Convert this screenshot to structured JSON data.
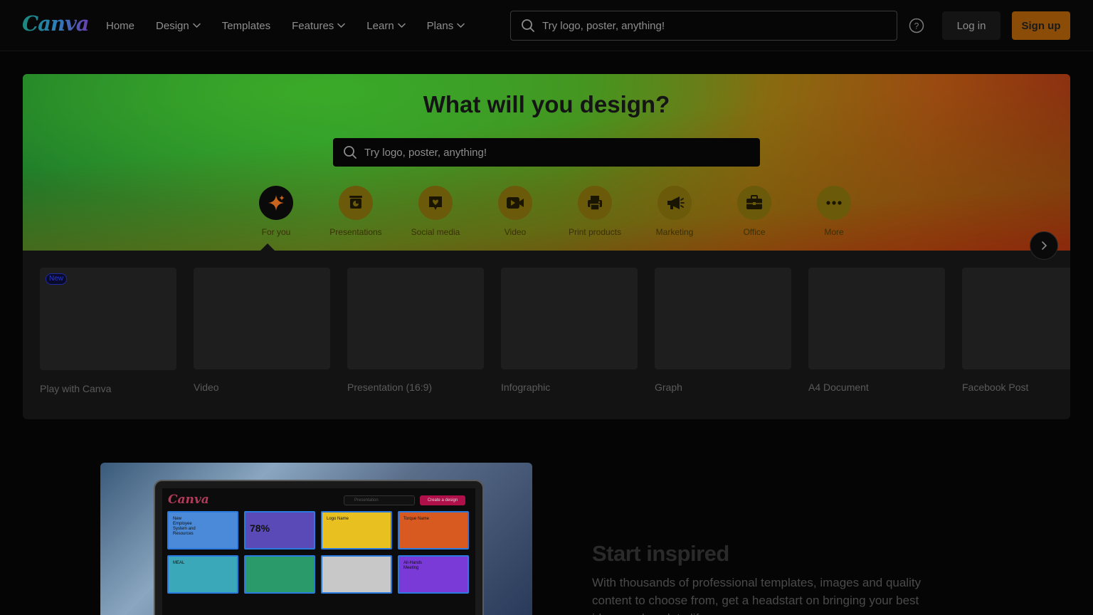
{
  "header": {
    "logo": "Canva",
    "nav": [
      {
        "label": "Home",
        "dropdown": false
      },
      {
        "label": "Design",
        "dropdown": true
      },
      {
        "label": "Templates",
        "dropdown": false
      },
      {
        "label": "Features",
        "dropdown": true
      },
      {
        "label": "Learn",
        "dropdown": true
      },
      {
        "label": "Plans",
        "dropdown": true
      }
    ],
    "search_placeholder": "Try logo, poster, anything!",
    "help_icon": "question-circle-icon",
    "login_label": "Log in",
    "signup_label": "Sign up"
  },
  "hero": {
    "title": "What will you design?",
    "search_placeholder": "Try logo, poster, anything!",
    "categories": [
      {
        "label": "For you",
        "icon": "sparkle-icon",
        "active": true
      },
      {
        "label": "Presentations",
        "icon": "presentation-icon",
        "active": false
      },
      {
        "label": "Social media",
        "icon": "heart-chat-icon",
        "active": false
      },
      {
        "label": "Video",
        "icon": "video-camera-icon",
        "active": false
      },
      {
        "label": "Print products",
        "icon": "printer-icon",
        "active": false
      },
      {
        "label": "Marketing",
        "icon": "megaphone-icon",
        "active": false
      },
      {
        "label": "Office",
        "icon": "briefcase-icon",
        "active": false
      },
      {
        "label": "More",
        "icon": "more-dots-icon",
        "active": false
      }
    ]
  },
  "designs": {
    "items": [
      {
        "label": "Play with Canva",
        "badge": "New"
      },
      {
        "label": "Video",
        "badge": ""
      },
      {
        "label": "Presentation (16:9)",
        "badge": ""
      },
      {
        "label": "Infographic",
        "badge": ""
      },
      {
        "label": "Graph",
        "badge": ""
      },
      {
        "label": "A4 Document",
        "badge": ""
      },
      {
        "label": "Facebook Post",
        "badge": ""
      }
    ],
    "next_icon": "chevron-right-icon"
  },
  "inspired": {
    "title": "Start inspired",
    "text": "With thousands of professional templates, images and quality content to choose from, get a headstart on bringing your best ideas and work to life.",
    "mockup": {
      "logo": "Canva",
      "search": "Presentation",
      "create_label": "Create a design",
      "cards": [
        {
          "text": "New Employee System and Resources",
          "big": "",
          "bg": "#4a8ad8"
        },
        {
          "text": "",
          "big": "78%",
          "bg": "#5a4ab8"
        },
        {
          "text": "Logo Name",
          "big": "",
          "bg": "#e8c020"
        },
        {
          "text": "Torque Name",
          "big": "",
          "bg": "#d85a20"
        },
        {
          "text": "MEAL",
          "big": "",
          "bg": "#3aa8b8"
        },
        {
          "text": "",
          "big": "",
          "bg": "#2a9a6a"
        },
        {
          "text": "",
          "big": "",
          "bg": "#c8c8c8"
        },
        {
          "text": "All-Hands Meeting",
          "big": "",
          "bg": "#7a3ad8"
        }
      ]
    }
  }
}
